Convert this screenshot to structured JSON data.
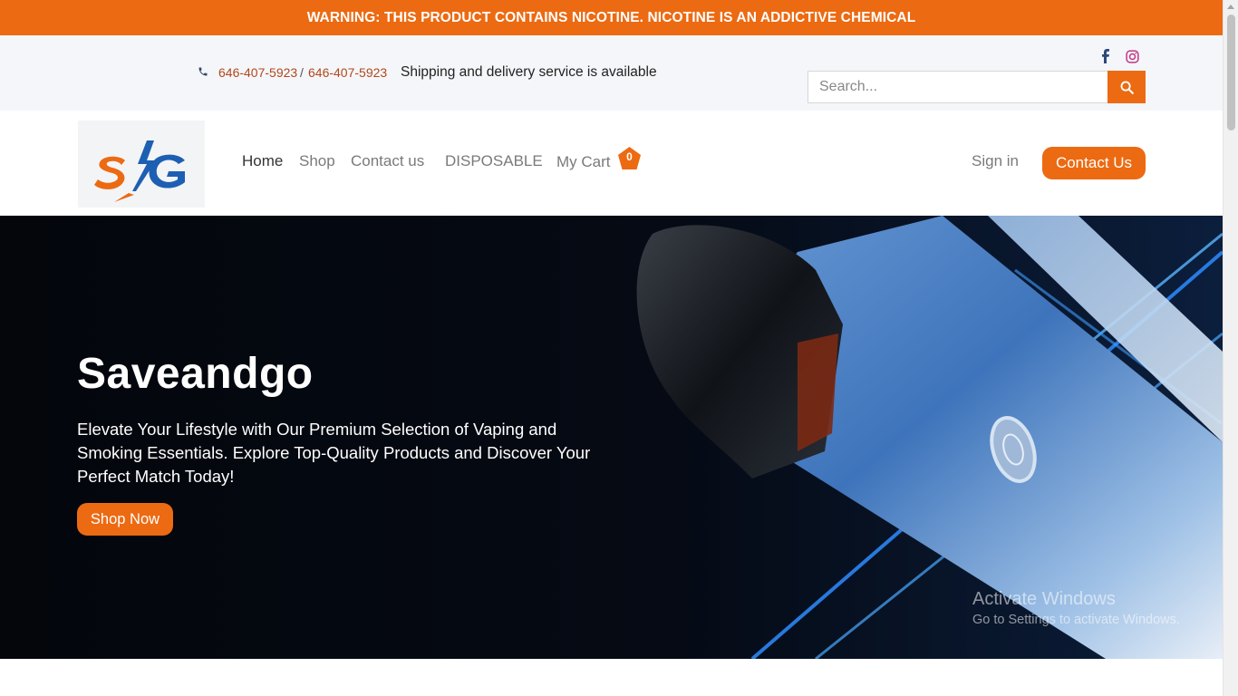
{
  "warning": {
    "text": "WARNING: THIS PRODUCT CONTAINS NICOTINE. NICOTINE IS AN ADDICTIVE CHEMICAL"
  },
  "topbar": {
    "phone_icon": "phone-icon",
    "phone_primary": "646-407-5923",
    "phone_separator": "/",
    "phone_secondary": "646-407-5923",
    "shipping_text": "Shipping and delivery service is available",
    "social": [
      "facebook-icon",
      "instagram-icon"
    ],
    "search_placeholder": "Search...",
    "search_icon": "search-icon"
  },
  "nav": {
    "logo_text": "SG",
    "items": [
      {
        "label": "Home",
        "active": true
      },
      {
        "label": "Shop",
        "active": false
      },
      {
        "label": "Contact us",
        "active": false
      },
      {
        "label": "DISPOSABLE",
        "active": false
      }
    ],
    "cart_label": "My Cart",
    "cart_count": "0",
    "signin_label": "Sign in",
    "contact_button": "Contact Us"
  },
  "hero": {
    "title": "Saveandgo",
    "subtitle": "Elevate Your Lifestyle with Our Premium Selection of Vaping and Smoking Essentials. Explore Top-Quality Products and Discover Your Perfect Match Today!",
    "cta": "Shop Now"
  },
  "watermark": {
    "title": "Activate Windows",
    "subtitle": "Go to Settings to activate Windows."
  },
  "colors": {
    "accent": "#ec6a12",
    "phone_link": "#b0491d",
    "hero_bg": "#04060c",
    "logo_orange": "#ec6a12",
    "logo_blue": "#1d5fb3"
  }
}
